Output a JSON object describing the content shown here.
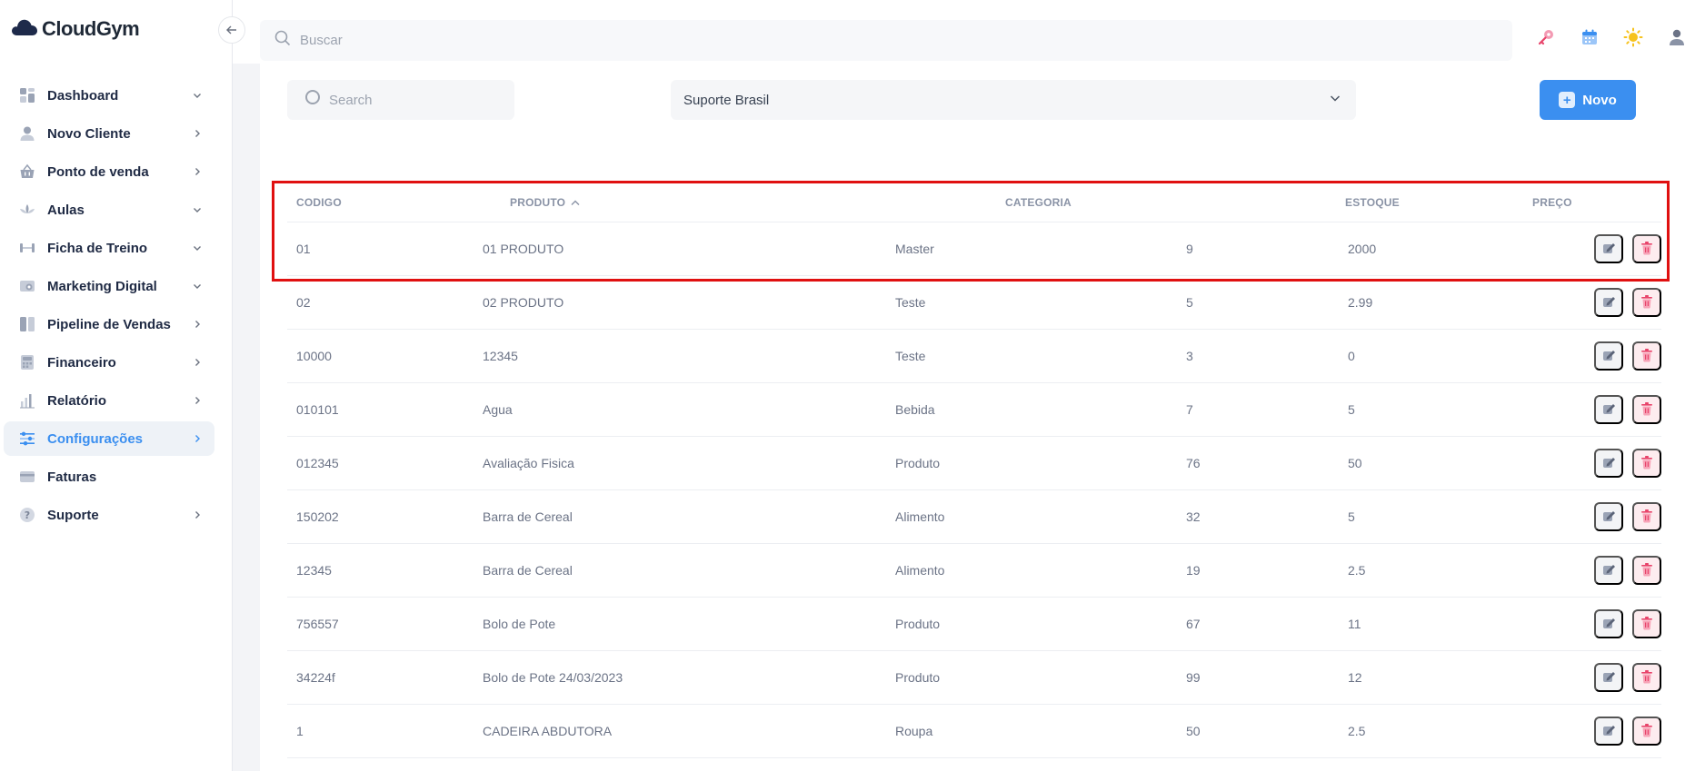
{
  "brand": {
    "name": "CloudGym"
  },
  "sidebar": {
    "items": [
      {
        "label": "Dashboard",
        "icon": "dashboard-icon",
        "chevron": "down",
        "active": false
      },
      {
        "label": "Novo Cliente",
        "icon": "user-icon",
        "chevron": "right",
        "active": false
      },
      {
        "label": "Ponto de venda",
        "icon": "basket-icon",
        "chevron": "right",
        "active": false
      },
      {
        "label": "Aulas",
        "icon": "lotus-icon",
        "chevron": "down",
        "active": false
      },
      {
        "label": "Ficha de Treino",
        "icon": "dumbbell-icon",
        "chevron": "down",
        "active": false
      },
      {
        "label": "Marketing Digital",
        "icon": "camera-icon",
        "chevron": "down",
        "active": false
      },
      {
        "label": "Pipeline de Vendas",
        "icon": "pipeline-icon",
        "chevron": "right",
        "active": false
      },
      {
        "label": "Financeiro",
        "icon": "calculator-icon",
        "chevron": "right",
        "active": false
      },
      {
        "label": "Relatório",
        "icon": "bar-chart-icon",
        "chevron": "right",
        "active": false
      },
      {
        "label": "Configurações",
        "icon": "sliders-icon",
        "chevron": "right",
        "active": true
      },
      {
        "label": "Faturas",
        "icon": "credit-card-icon",
        "chevron": "",
        "active": false
      },
      {
        "label": "Suporte",
        "icon": "help-icon",
        "chevron": "right",
        "active": false
      }
    ]
  },
  "topbar": {
    "search_placeholder": "Buscar"
  },
  "filters": {
    "search_placeholder": "Search",
    "select_value": "Suporte Brasil",
    "new_button": "Novo"
  },
  "table": {
    "headers": [
      "CODIGO",
      "PRODUTO",
      "CATEGORIA",
      "ESTOQUE",
      "PREÇO"
    ],
    "rows": [
      [
        "01",
        "01 PRODUTO",
        "Master",
        "9",
        "2000"
      ],
      [
        "02",
        "02 PRODUTO",
        "Teste",
        "5",
        "2.99"
      ],
      [
        "10000",
        "12345",
        "Teste",
        "3",
        "0"
      ],
      [
        "010101",
        "Agua",
        "Bebida",
        "7",
        "5"
      ],
      [
        "012345",
        "Avaliação Fisica",
        "Produto",
        "76",
        "50"
      ],
      [
        "150202",
        "Barra de Cereal",
        "Alimento",
        "32",
        "5"
      ],
      [
        "12345",
        "Barra de Cereal",
        "Alimento",
        "19",
        "2.5"
      ],
      [
        "756557",
        "Bolo de Pote",
        "Produto",
        "67",
        "11"
      ],
      [
        "34224f",
        "Bolo de Pote 24/03/2023",
        "Produto",
        "99",
        "12"
      ],
      [
        "1",
        "CADEIRA ABDUTORA",
        "Roupa",
        "50",
        "2.5"
      ]
    ]
  },
  "colors": {
    "accent": "#3b8ff0",
    "delete": "#e8436a",
    "highlight": "#e01010"
  }
}
